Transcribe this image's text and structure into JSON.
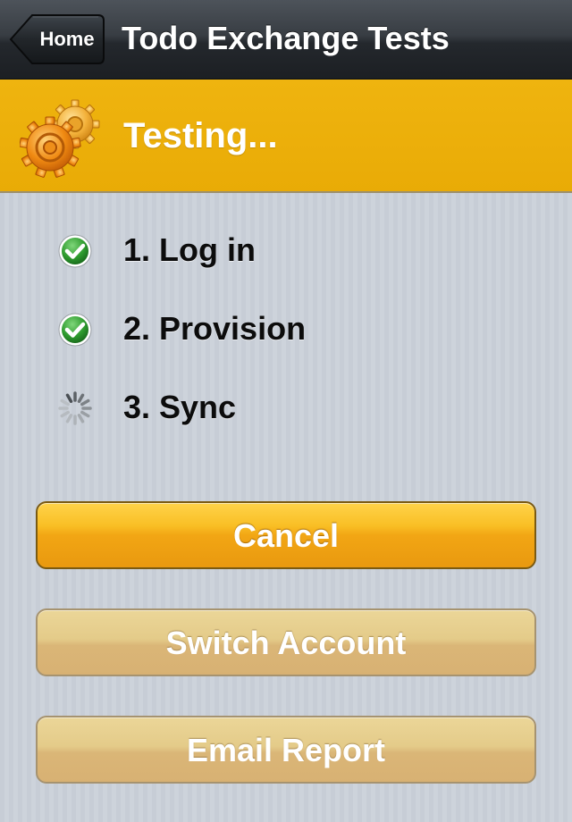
{
  "navbar": {
    "back_label": "Home",
    "title": "Todo Exchange Tests"
  },
  "status": {
    "title": "Testing...",
    "icon": "gears-icon",
    "background_color": "#ecae0a"
  },
  "steps": [
    {
      "label": "1. Log in",
      "state": "complete",
      "icon": "checkmark-icon"
    },
    {
      "label": "2. Provision",
      "state": "complete",
      "icon": "checkmark-icon"
    },
    {
      "label": "3. Sync",
      "state": "in-progress",
      "icon": "spinner-icon"
    }
  ],
  "buttons": {
    "cancel": "Cancel",
    "switch_account": "Switch Account",
    "email_report": "Email Report"
  },
  "colors": {
    "accent": "#f2a614",
    "check_green": "#2e9b2e",
    "navbar": "#2b2f34"
  }
}
